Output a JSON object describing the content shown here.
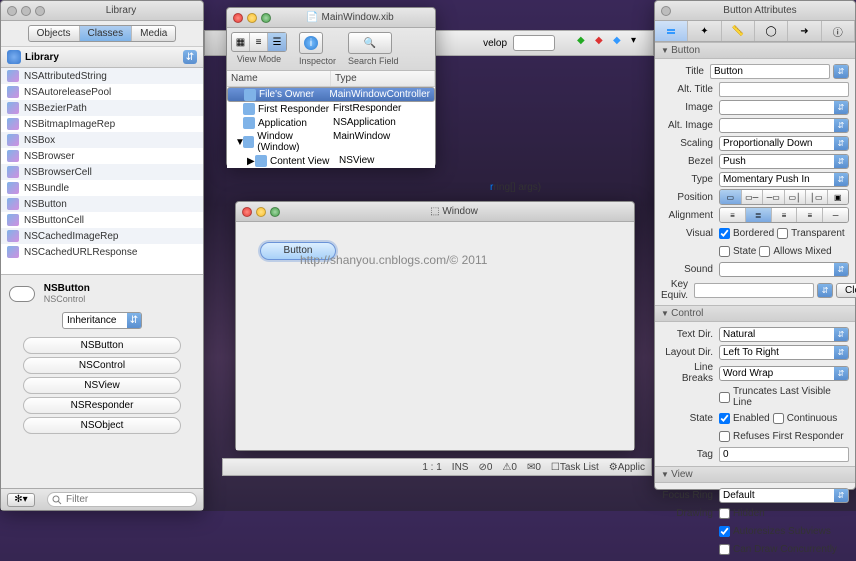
{
  "library": {
    "title": "Library",
    "tabs": [
      "Objects",
      "Classes",
      "Media"
    ],
    "active_tab": 1,
    "header": "Library",
    "classes": [
      "NSAttributedString",
      "NSAutoreleasePool",
      "NSBezierPath",
      "NSBitmapImageRep",
      "NSBox",
      "NSBrowser",
      "NSBrowserCell",
      "NSBundle",
      "NSButton",
      "NSButtonCell",
      "NSCachedImageRep",
      "NSCachedURLResponse"
    ],
    "selected_class": "NSButton",
    "selected_parent": "NSControl",
    "inheritance_label": "Inheritance",
    "hierarchy": [
      "NSButton",
      "NSControl",
      "NSView",
      "NSResponder",
      "NSObject"
    ],
    "filter_placeholder": "Filter"
  },
  "xib": {
    "title": "MainWindow.xib",
    "view_mode_label": "View Mode",
    "inspector_label": "Inspector",
    "search_label": "Search Field",
    "col_name": "Name",
    "col_type": "Type",
    "rows": [
      {
        "name": "File's Owner",
        "type": "MainWindowController",
        "sel": true,
        "indent": 0
      },
      {
        "name": "First Responder",
        "type": "FirstResponder",
        "indent": 0
      },
      {
        "name": "Application",
        "type": "NSApplication",
        "indent": 0
      },
      {
        "name": "Window (Window)",
        "type": "MainWindow",
        "indent": 0,
        "exp": true
      },
      {
        "name": "Content View",
        "type": "NSView",
        "indent": 1,
        "exp": false
      }
    ]
  },
  "toolstrip": {
    "label": "velop"
  },
  "code": {
    "text": "ring[] args)"
  },
  "window": {
    "title": "Window",
    "button": "Button"
  },
  "watermark": "http://shanyou.cnblogs.com/© 2011",
  "statusbar": {
    "pos": "1 : 1",
    "mode": "INS",
    "err": "0",
    "warn": "0",
    "msg": "0",
    "tasklist": "Task List",
    "app": "Applic"
  },
  "inspector": {
    "title": "Button Attributes",
    "section_button": "Button",
    "title_lbl": "Title",
    "title_val": "Button",
    "alt_title_lbl": "Alt. Title",
    "alt_title_val": "",
    "image_lbl": "Image",
    "alt_image_lbl": "Alt. Image",
    "scaling_lbl": "Scaling",
    "scaling_val": "Proportionally Down",
    "bezel_lbl": "Bezel",
    "bezel_val": "Push",
    "type_lbl": "Type",
    "type_val": "Momentary Push In",
    "position_lbl": "Position",
    "alignment_lbl": "Alignment",
    "visual_lbl": "Visual",
    "bordered": "Bordered",
    "transparent": "Transparent",
    "state_chk": "State",
    "allows_mixed": "Allows Mixed",
    "sound_lbl": "Sound",
    "keyequiv_lbl": "Key Equiv.",
    "clear": "Clear",
    "section_control": "Control",
    "textdir_lbl": "Text Dir.",
    "textdir_val": "Natural",
    "layoutdir_lbl": "Layout Dir.",
    "layoutdir_val": "Left To Right",
    "linebreaks_lbl": "Line Breaks",
    "linebreaks_val": "Word Wrap",
    "trunc": "Truncates Last Visible Line",
    "state_lbl": "State",
    "enabled": "Enabled",
    "continuous": "Continuous",
    "refuses": "Refuses First Responder",
    "tag_lbl": "Tag",
    "tag_val": "0",
    "section_view": "View",
    "focusring_lbl": "Focus Ring",
    "focusring_val": "Default",
    "drawing_lbl": "Drawing",
    "hidden": "Hidden",
    "autoresizes": "Autoresizes Subviews",
    "candraw": "Can Draw Concurrently"
  }
}
